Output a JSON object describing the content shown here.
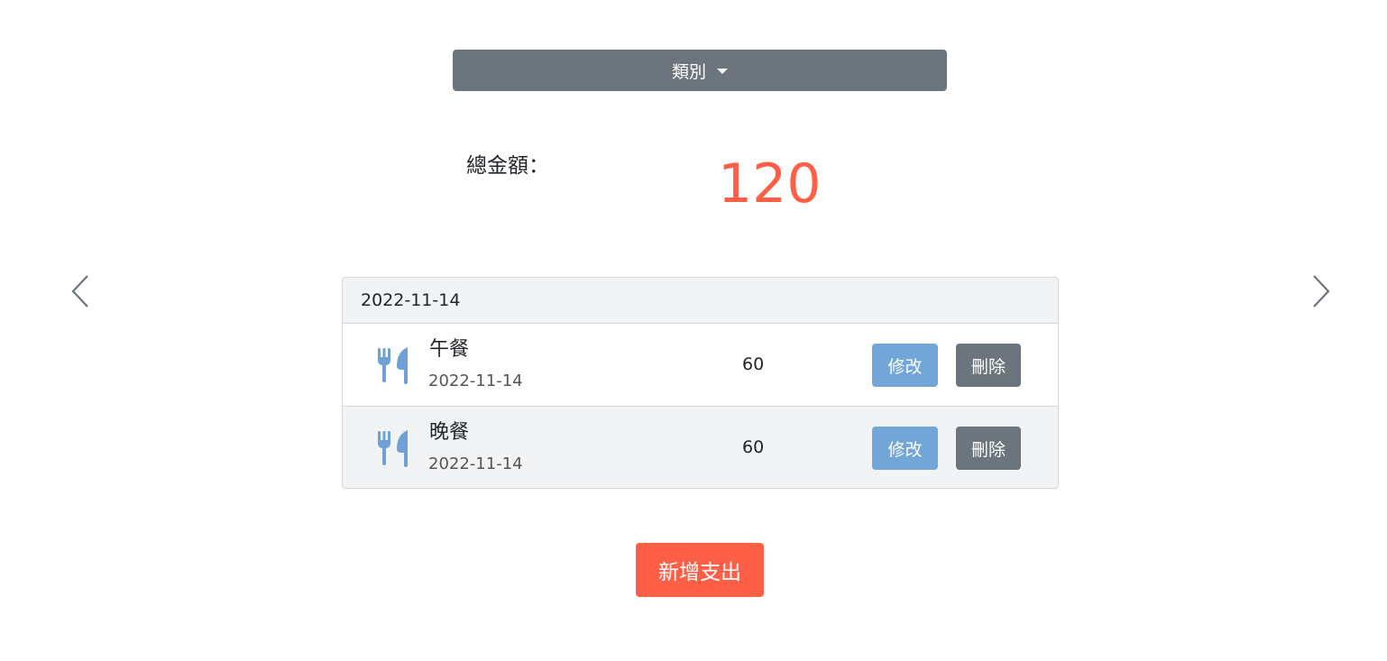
{
  "filter": {
    "category_label": "類別"
  },
  "summary": {
    "total_label": "總金額：",
    "total_amount": "120"
  },
  "records": {
    "date_header": "2022-11-14",
    "items": [
      {
        "name": "午餐",
        "date": "2022-11-14",
        "amount": "60",
        "icon": "utensils-icon",
        "edit_label": "修改",
        "delete_label": "刪除"
      },
      {
        "name": "晚餐",
        "date": "2022-11-14",
        "amount": "60",
        "icon": "utensils-icon",
        "edit_label": "修改",
        "delete_label": "刪除"
      }
    ]
  },
  "actions": {
    "add_label": "新增支出"
  },
  "colors": {
    "accent": "#ff5f46",
    "secondary": "#6c757d",
    "edit": "#72a6d8",
    "icon": "#6fa1d4"
  }
}
